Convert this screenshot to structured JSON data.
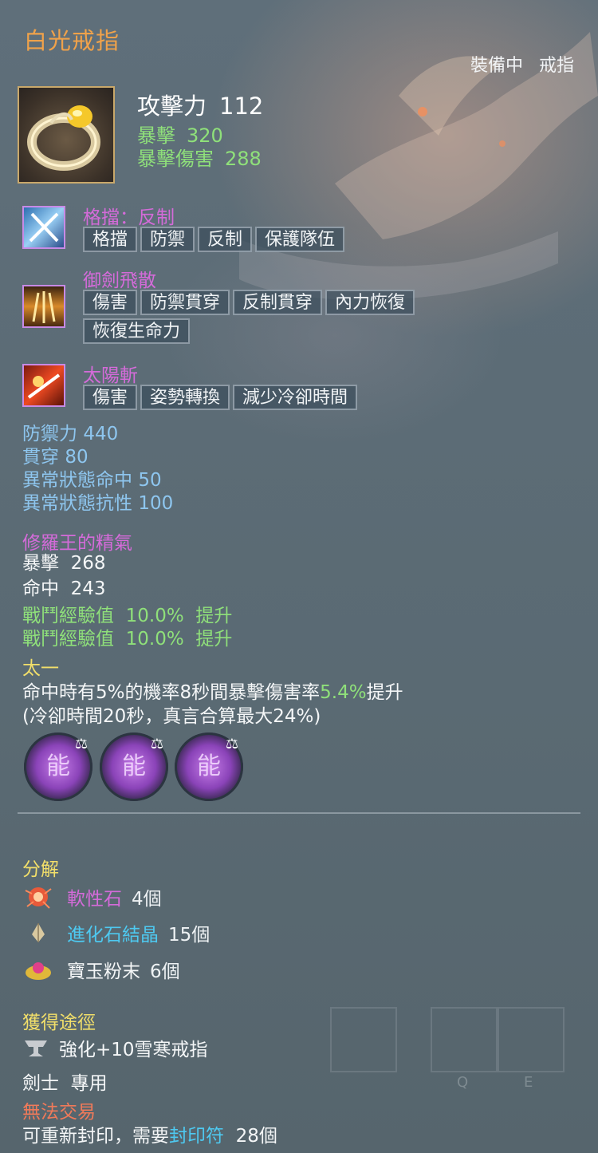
{
  "title": "白光戒指",
  "equip": {
    "status": "裝備中",
    "slot": "戒指"
  },
  "main_stats": {
    "attack_label": "攻擊力",
    "attack_value": "112",
    "crit_label": "暴擊",
    "crit_value": "320",
    "crit_dmg_label": "暴擊傷害",
    "crit_dmg_value": "288"
  },
  "skills": [
    {
      "name": "格擋：反制",
      "tags": [
        "格擋",
        "防禦",
        "反制",
        "保護隊伍"
      ]
    },
    {
      "name": "御劍飛散",
      "tags": [
        "傷害",
        "防禦貫穿",
        "反制貫穿",
        "內力恢復",
        "恢復生命力"
      ]
    },
    {
      "name": "太陽斬",
      "tags": [
        "傷害",
        "姿勢轉換",
        "減少冷卻時間"
      ]
    }
  ],
  "sub_stats": [
    {
      "label": "防禦力",
      "value": "440"
    },
    {
      "label": "貫穿",
      "value": "80"
    },
    {
      "label": "異常狀態命中",
      "value": "50"
    },
    {
      "label": "異常狀態抗性",
      "value": "100"
    }
  ],
  "bonus": {
    "title": "修羅王的精氣",
    "lines": [
      {
        "label": "暴擊",
        "value": "268"
      },
      {
        "label": "命中",
        "value": "243"
      }
    ]
  },
  "exp_lines": [
    {
      "label": "戰鬥經驗值",
      "value": "10.0%",
      "suffix": "提升"
    },
    {
      "label": "戰鬥經驗值",
      "value": "10.0%",
      "suffix": "提升"
    }
  ],
  "effect": {
    "title": "太一",
    "line1_pre": "命中時有5%的機率8秒間暴擊傷害率",
    "line1_value": "5.4%",
    "line1_post": "提升",
    "line2": "(冷卻時間20秒，真言合算最大24%)"
  },
  "gems": [
    {
      "glyph": "能",
      "icon": "scale-icon"
    },
    {
      "glyph": "能",
      "icon": "scale-icon"
    },
    {
      "glyph": "能",
      "icon": "scale-icon"
    }
  ],
  "decompose": {
    "title": "分解",
    "items": [
      {
        "name": "軟性石",
        "count": "4個",
        "color": "#d46bd9",
        "icon": "soft-stone-icon"
      },
      {
        "name": "進化石結晶",
        "count": "15個",
        "color": "#4ec9f0",
        "icon": "evolution-crystal-icon"
      },
      {
        "name": "寶玉粉末",
        "count": "6個",
        "color": "#f4f6f7",
        "icon": "jade-powder-icon"
      }
    ]
  },
  "acquire": {
    "title": "獲得途徑",
    "source": "強化+10雪寒戒指"
  },
  "restriction": {
    "class": "劍士",
    "exclusive": "專用"
  },
  "trade": {
    "label": "無法交易",
    "reseal_pre": "可重新封印，需要",
    "reseal_item": "封印符",
    "reseal_count": "28個"
  },
  "hotkeys": [
    "Q",
    "E"
  ],
  "colors": {
    "title": "#f0a24a",
    "skill": "#d46bd9",
    "green": "#8fe07a",
    "blue": "#8ec6ef",
    "yellow": "#f2df6a",
    "cyan": "#4ec9f0"
  }
}
